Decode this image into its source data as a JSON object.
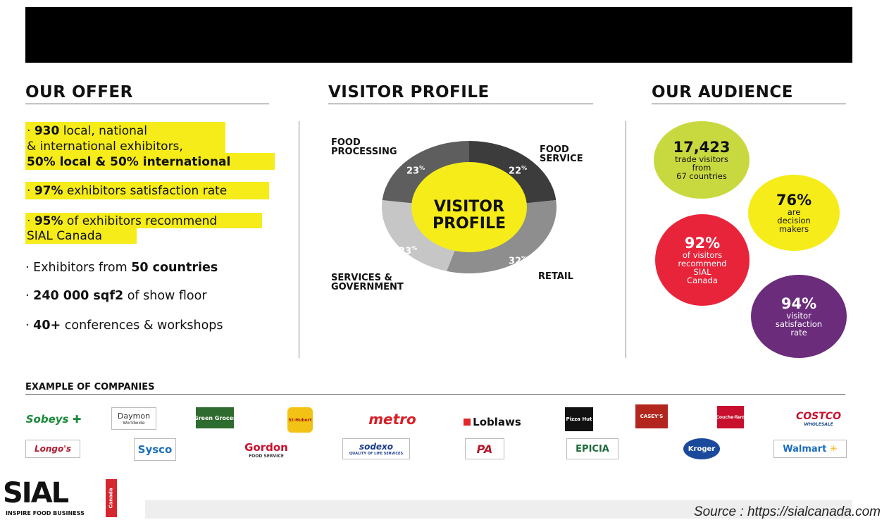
{
  "sections": {
    "offer_title": "OUR OFFER",
    "visitor_title": "VISITOR PROFILE",
    "audience_title": "OUR AUDIENCE"
  },
  "offer": {
    "item1_num": "930",
    "item1_line1": " local, national",
    "item1_line2": "& international exhibitors,",
    "item1_line3": "50% local & 50% international",
    "item2_num": "97%",
    "item2_text": " exhibitors satisfaction rate",
    "item3_num": "95%",
    "item3_text": " of exhibitors recommend",
    "item3_line2": "SIAL Canada",
    "item4_text": "Exhibitors from ",
    "item4_bold": "50 countries",
    "item5_bold": "240 000 sqf2",
    "item5_text": " of show floor",
    "item6_bold": "40+",
    "item6_text": " conferences & workshops"
  },
  "profile": {
    "center_line1": "VISITOR",
    "center_line2": "PROFILE",
    "seg_food_processing_l1": "FOOD",
    "seg_food_processing_l2": "PROCESSING",
    "seg_food_service_l1": "FOOD",
    "seg_food_service_l2": "SERVICE",
    "seg_retail": "RETAIL",
    "seg_services_l1": "SERVICES &",
    "seg_services_l2": "GOVERNMENT",
    "pct_food_processing": "23",
    "pct_food_service": "22",
    "pct_retail": "32",
    "pct_services": "23",
    "pct_sign": "%",
    "colors": {
      "food_service": "#3c3c3c",
      "retail": "#8e8e8e",
      "services": "#c6c6c6",
      "food_processing": "#5e5e5e",
      "center": "#f5ec1a"
    }
  },
  "audience": {
    "b1_big": "17,423",
    "b1_l1": "trade visitors",
    "b1_l2": "from",
    "b1_l3": "67 countries",
    "b2_big": "76%",
    "b2_l1": "are",
    "b2_l2": "decision",
    "b2_l3": "makers",
    "b3_big": "92%",
    "b3_l1": "of visitors",
    "b3_l2": "recommend",
    "b3_l3": "SIAL",
    "b3_l4": "Canada",
    "b4_big": "94%",
    "b4_l1": "visitor",
    "b4_l2": "satisfaction",
    "b4_l3": "rate"
  },
  "companies": {
    "title": "EXAMPLE OF COMPANIES",
    "sobeys": "Sobeys",
    "daymon": "Daymon",
    "daymon_sub": "Worldwide",
    "greengrocer": "Green Grocer",
    "sthubert": "St-Hubert",
    "metro": "metro",
    "loblaws": "Loblaws",
    "pizzahut": "Pizza Hut",
    "caseys": "CASEY'S",
    "couchetard": "Couche-Tard",
    "costco": "COSTCO",
    "costco_sub": "WHOLESALE",
    "longos": "Longo's",
    "sysco": "Sysco",
    "gordon": "Gordon",
    "gordon_sub": "FOOD SERVICE",
    "sodexo": "sodexo",
    "sodexo_sub": "QUALITY OF LIFE SERVICES",
    "pa": "PA",
    "epicia": "EPICIA",
    "kroger": "Kroger",
    "walmart": "Walmart"
  },
  "footer": {
    "logo": "SIAL",
    "logo_tag": "INSPIRE FOOD BUSINESS",
    "logo_side": "Canada",
    "source": "Source : https://sialcanada.com"
  }
}
